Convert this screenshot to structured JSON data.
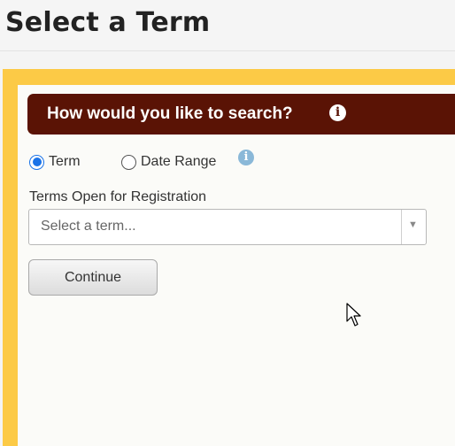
{
  "header": {
    "title": "Select a Term"
  },
  "search": {
    "heading": "How would you like to search?",
    "info_icon": "info-icon",
    "options": [
      {
        "label": "Term",
        "checked": true
      },
      {
        "label": "Date Range",
        "checked": false
      }
    ],
    "date_range_info_icon": "info-icon"
  },
  "term_field": {
    "label": "Terms Open for Registration",
    "placeholder": "Select a term..."
  },
  "actions": {
    "continue_label": "Continue"
  },
  "colors": {
    "accent_gold": "#fcca46",
    "heading_bar": "#5a1305",
    "radio_selected": "#1a73e8",
    "info_blue": "#8ab8d8"
  }
}
